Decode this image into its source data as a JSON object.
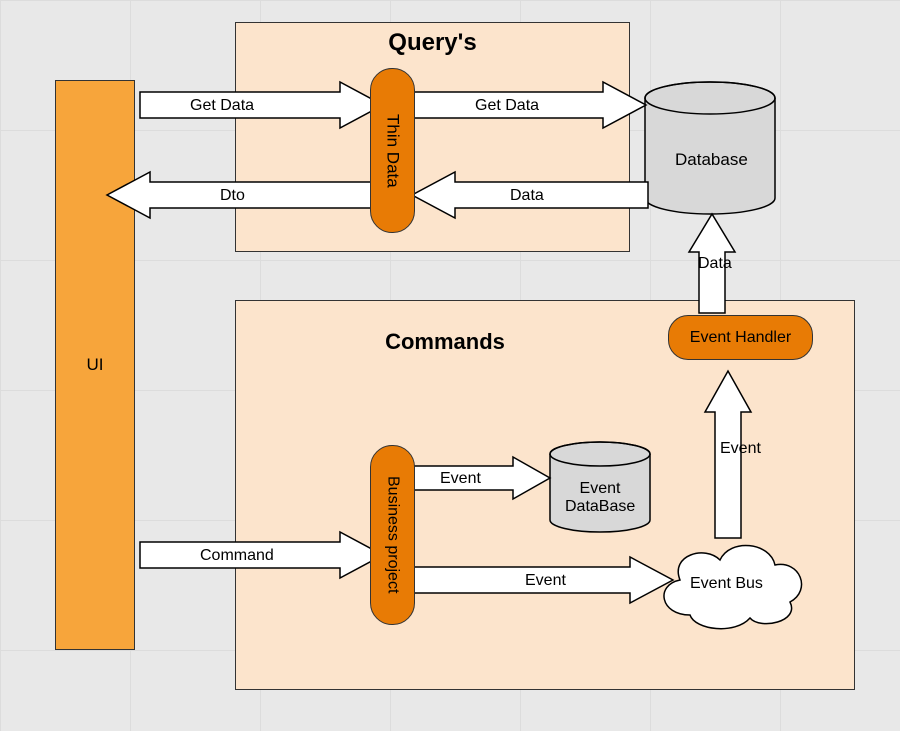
{
  "ui": {
    "label": "UI"
  },
  "query": {
    "title": "Query's",
    "getData1": "Get Data",
    "getData2": "Get Data",
    "dto": "Dto",
    "data": "Data",
    "thinData": "Thin Data",
    "database": "Database"
  },
  "commands": {
    "title": "Commands",
    "command": "Command",
    "businessProject": "Business project",
    "eventToDb": "Event",
    "eventToBus": "Event",
    "eventDatabase": "Event\nDataBase",
    "eventBus": "Event Bus",
    "eventUp": "Event",
    "eventHandler": "Event Handler",
    "dataUp": "Data"
  }
}
